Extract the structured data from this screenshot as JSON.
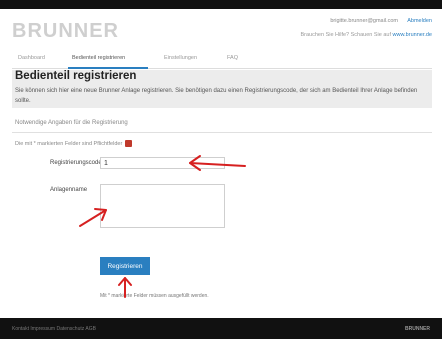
{
  "brand": {
    "logo_text": "BRUNNER"
  },
  "account": {
    "email": "brigitte.brunner@gmail.com",
    "logout_label": "Abmelden"
  },
  "help": {
    "text": "Brauchen Sie Hilfe? Schauen Sie auf",
    "link": "www.brunner.de"
  },
  "nav": {
    "items": [
      {
        "label": "Dashboard",
        "active": false
      },
      {
        "label": "Bedienteil registrieren",
        "active": true
      },
      {
        "label": "Einstellungen",
        "active": false
      },
      {
        "label": "FAQ",
        "active": false
      }
    ]
  },
  "page": {
    "title": "Bedienteil registrieren",
    "description": "Sie können sich hier eine neue Brunner Anlage registrieren. Sie benötigen dazu einen Registrierungscode, der sich am Bedienteil Ihrer Anlage befinden sollte."
  },
  "form": {
    "section_heading": "Notwendige Angaben für die Registrierung",
    "required_note": "Die mit * markierten Felder sind Pflichtfelder",
    "code_label": "Registrierungscode *",
    "code_value": "1",
    "name_label": "Anlagenname",
    "name_value": "",
    "submit_label": "Registrieren",
    "footnote": "Mit * markierte Felder müssen ausgefüllt werden."
  },
  "footer": {
    "links": "Kontakt   Impressum   Datenschutz   AGB",
    "brand": "BRUNNER"
  },
  "colors": {
    "accent": "#2a7fc0",
    "annotation": "#d62020",
    "topbar": "#111111",
    "header_band": "#ececec"
  }
}
